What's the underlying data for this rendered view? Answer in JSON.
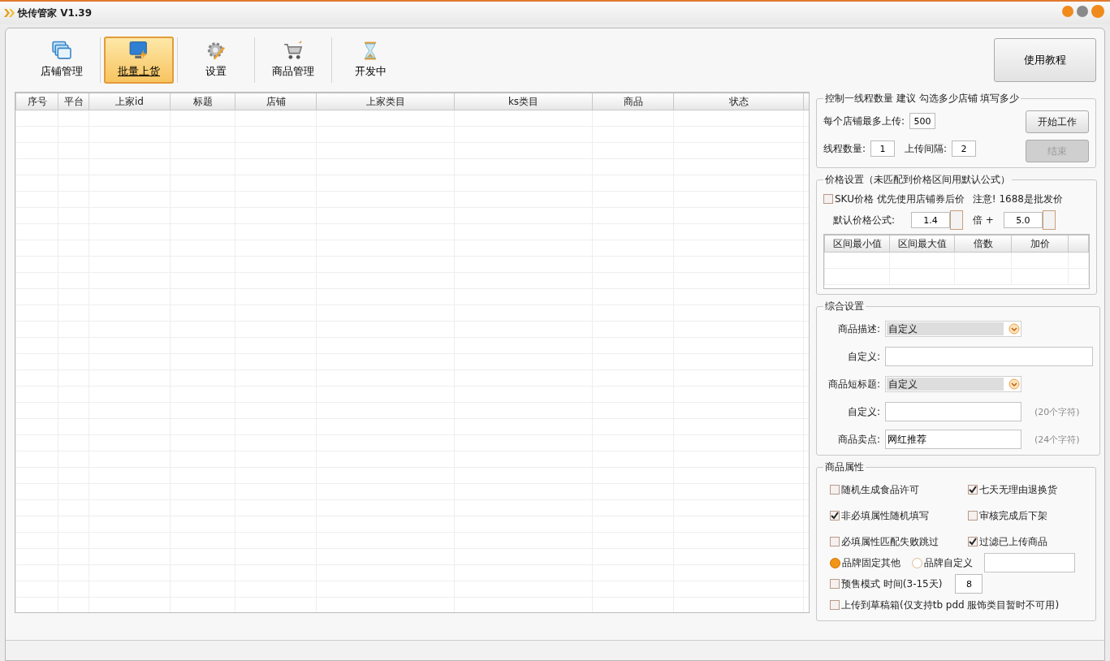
{
  "window": {
    "title": "快传管家 V1.39"
  },
  "toolbar": [
    {
      "kind": "windows",
      "label": "店铺管理",
      "selected": false
    },
    {
      "kind": "monitor",
      "label": "批量上货",
      "selected": true
    },
    {
      "kind": "gear",
      "label": "设置",
      "selected": false
    },
    {
      "kind": "cart",
      "label": "商品管理",
      "selected": false
    },
    {
      "kind": "hourglass",
      "label": "开发中",
      "selected": false
    }
  ],
  "help_button": "使用教程",
  "table": {
    "columns": [
      "序号",
      "平台",
      "上家id",
      "标题",
      "店铺",
      "上家类目",
      "ks类目",
      "商品",
      "状态"
    ]
  },
  "thread_group": {
    "title": "控制一线程数量 建议 勾选多少店铺 填写多少",
    "max_label": "每个店铺最多上传:",
    "max_value": "500",
    "threads_label": "线程数量:",
    "threads_value": "1",
    "interval_label": "上传间隔:",
    "interval_value": "2",
    "buttons": [
      {
        "label": "开始工作",
        "disabled": false
      },
      {
        "label": "结束",
        "disabled": true
      }
    ]
  },
  "price_group": {
    "title": "价格设置（未匹配到价格区间用默认公式）",
    "sku": {
      "label": "SKU价格 优先使用店铺券后价",
      "checked": false
    },
    "note": "注意! 1688是批发价",
    "formula_label": "默认价格公式:",
    "multiplier": "1.4",
    "times": "倍 +",
    "addend": "5.0",
    "columns": [
      "区间最小值",
      "区间最大值",
      "倍数",
      "加价"
    ]
  },
  "general_group": {
    "title": "综合设置",
    "rows": [
      {
        "kind": "select",
        "label": "商品描述:",
        "value": "自定义"
      },
      {
        "kind": "input",
        "label": "自定义:",
        "value": ""
      },
      {
        "kind": "select",
        "label": "商品短标题:",
        "value": "自定义"
      },
      {
        "kind": "input",
        "label": "自定义:",
        "value": "",
        "hint": "(20个字符)"
      },
      {
        "kind": "input",
        "label": "商品卖点:",
        "value": "网红推荐",
        "hint": "(24个字符)"
      }
    ]
  },
  "attr_group": {
    "title": "商品属性",
    "checks": [
      {
        "label": "随机生成食品许可",
        "checked": false
      },
      {
        "label": "七天无理由退换货",
        "checked": true
      },
      {
        "label": "非必填属性随机填写",
        "checked": true
      },
      {
        "label": "审核完成后下架",
        "checked": false
      },
      {
        "label": "必填属性匹配失败跳过",
        "checked": false
      },
      {
        "label": "过滤已上传商品",
        "checked": true
      }
    ],
    "brand": [
      {
        "label": "品牌固定其他",
        "selected": true
      },
      {
        "label": "品牌自定义",
        "selected": false
      }
    ],
    "presale": {
      "label": "预售模式 时间(3-15天)",
      "checked": false,
      "value": "8"
    },
    "draft": {
      "label": "上传到草稿箱(仅支持tb pdd 服饰类目暂时不可用)",
      "checked": false
    }
  }
}
